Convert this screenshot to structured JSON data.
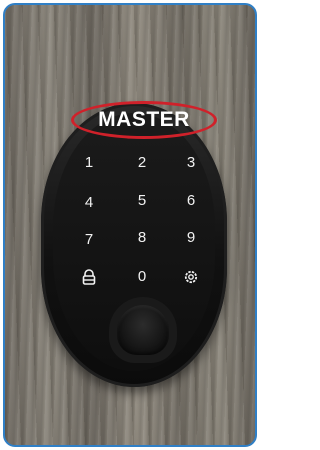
{
  "label": {
    "text": "MASTER",
    "highlight_color": "#d0212a"
  },
  "keypad": {
    "rows": [
      [
        "1",
        "2",
        "3"
      ],
      [
        "4",
        "5",
        "6"
      ],
      [
        "7",
        "8",
        "9"
      ],
      [
        "lock-icon",
        "0",
        "gear-icon"
      ]
    ]
  },
  "frame": {
    "border_color": "#2f7fc6"
  }
}
